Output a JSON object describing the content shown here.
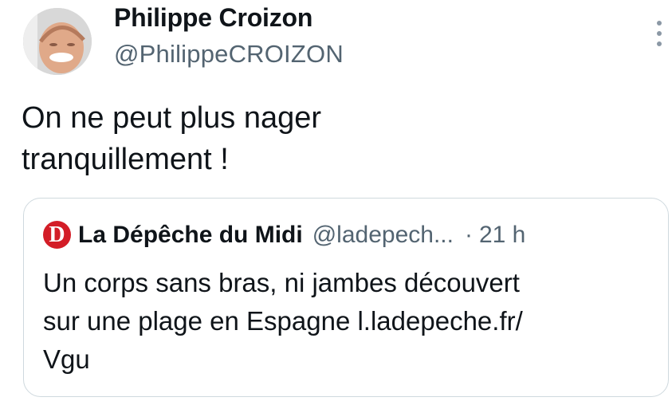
{
  "author": {
    "name": "Philippe Croizon",
    "handle": "@PhilippeCROIZON"
  },
  "tweet": {
    "text_line1": "On ne peut plus nager",
    "text_line2": "tranquillement !"
  },
  "quote": {
    "source_logo_letter": "D",
    "source_name": "La Dépêche du Midi",
    "source_handle": "@ladepech...",
    "separator": "·",
    "time": "21 h",
    "text_line1": "Un corps sans bras, ni jambes découvert",
    "text_line2": "sur une plage en Espagne l.ladepeche.fr/",
    "text_line3": "Vgu"
  },
  "colors": {
    "text": "#0f1419",
    "secondary_text": "#536471",
    "border": "#cfd9de",
    "source_logo": "#d31d27"
  },
  "icons": {
    "more": "vertical-ellipsis-icon",
    "avatar": "profile-photo"
  }
}
